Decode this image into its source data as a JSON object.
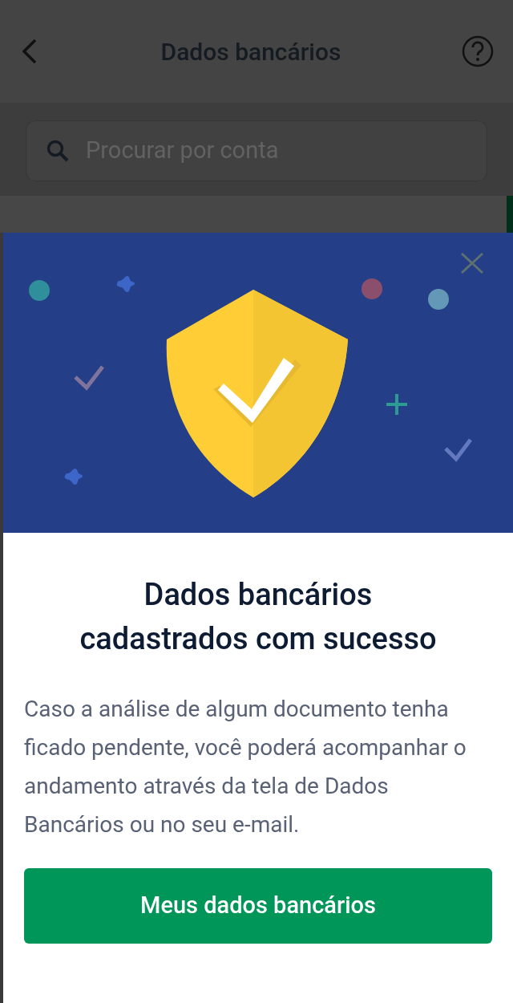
{
  "header": {
    "title": "Dados bancários"
  },
  "search": {
    "placeholder": "Procurar por conta"
  },
  "modal": {
    "title": "Dados bancários cadastrados com sucesso",
    "message": "Caso a análise de algum documento tenha ficado pendente, você poderá acompanhar o andamento através da tela de Dados Bancários ou no seu e-mail.",
    "button": "Meus dados bancários"
  }
}
